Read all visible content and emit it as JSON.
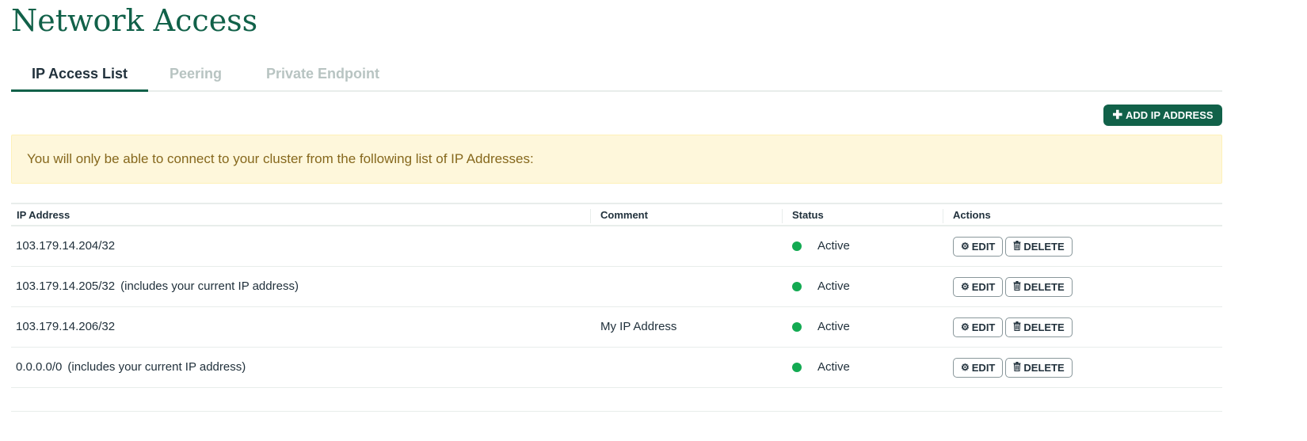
{
  "page": {
    "title": "Network Access"
  },
  "tabs": [
    {
      "label": "IP Access List",
      "active": true
    },
    {
      "label": "Peering",
      "active": false
    },
    {
      "label": "Private Endpoint",
      "active": false
    }
  ],
  "toolbar": {
    "add_label": "ADD IP ADDRESS",
    "add_icon": "plus-icon"
  },
  "banner": {
    "text": "You will only be able to connect to your cluster from the following list of IP Addresses:"
  },
  "table": {
    "headers": {
      "ip": "IP Address",
      "comment": "Comment",
      "status": "Status",
      "actions": "Actions"
    },
    "rows": [
      {
        "ip": "103.179.14.204/32",
        "note": "",
        "comment": "",
        "status": "Active"
      },
      {
        "ip": "103.179.14.205/32",
        "note": "(includes your current IP address)",
        "comment": "",
        "status": "Active"
      },
      {
        "ip": "103.179.14.206/32",
        "note": "",
        "comment": "My IP Address",
        "status": "Active"
      },
      {
        "ip": "0.0.0.0/0",
        "note": "(includes your current IP address)",
        "comment": "",
        "status": "Active"
      }
    ],
    "edit_label": "EDIT",
    "delete_label": "DELETE",
    "edit_icon": "gear-icon",
    "delete_icon": "trash-icon"
  },
  "colors": {
    "brand": "#116149",
    "status_active": "#13aa52",
    "banner_bg": "#fef7db",
    "banner_text": "#86681d"
  }
}
